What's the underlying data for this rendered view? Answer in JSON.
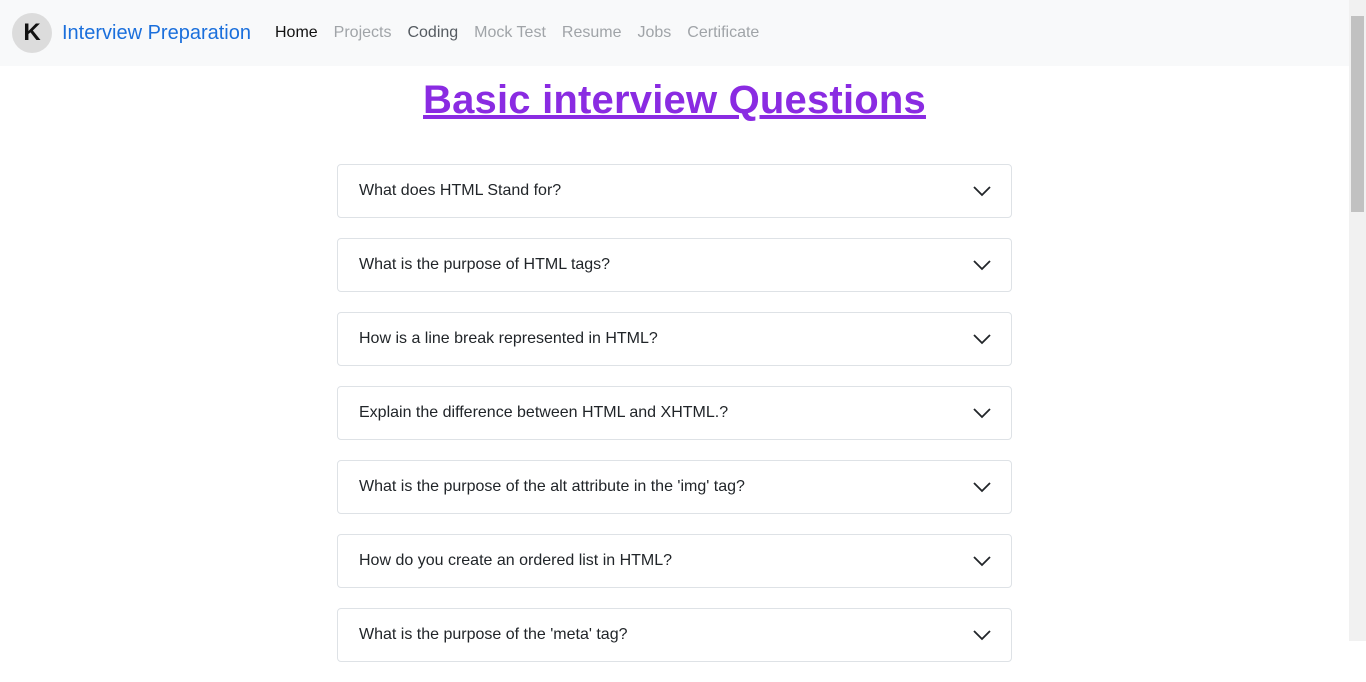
{
  "navbar": {
    "logo_letter": "K",
    "brand": "Interview Preparation",
    "links": [
      "Home",
      "Projects",
      "Coding",
      "Mock Test",
      "Resume",
      "Jobs",
      "Certificate"
    ]
  },
  "page": {
    "title": "Basic interview Questions"
  },
  "questions": [
    "What does HTML Stand for?",
    "What is the purpose of HTML tags?",
    "How is a line break represented in HTML?",
    "Explain the difference between HTML and XHTML.?",
    "What is the purpose of the alt attribute in the 'img' tag?",
    "How do you create an ordered list in HTML?",
    "What is the purpose of the 'meta' tag?"
  ],
  "colors": {
    "accent": "#1a6fdc",
    "title": "#8a2be2",
    "navbar_bg": "#f8f9fa"
  }
}
